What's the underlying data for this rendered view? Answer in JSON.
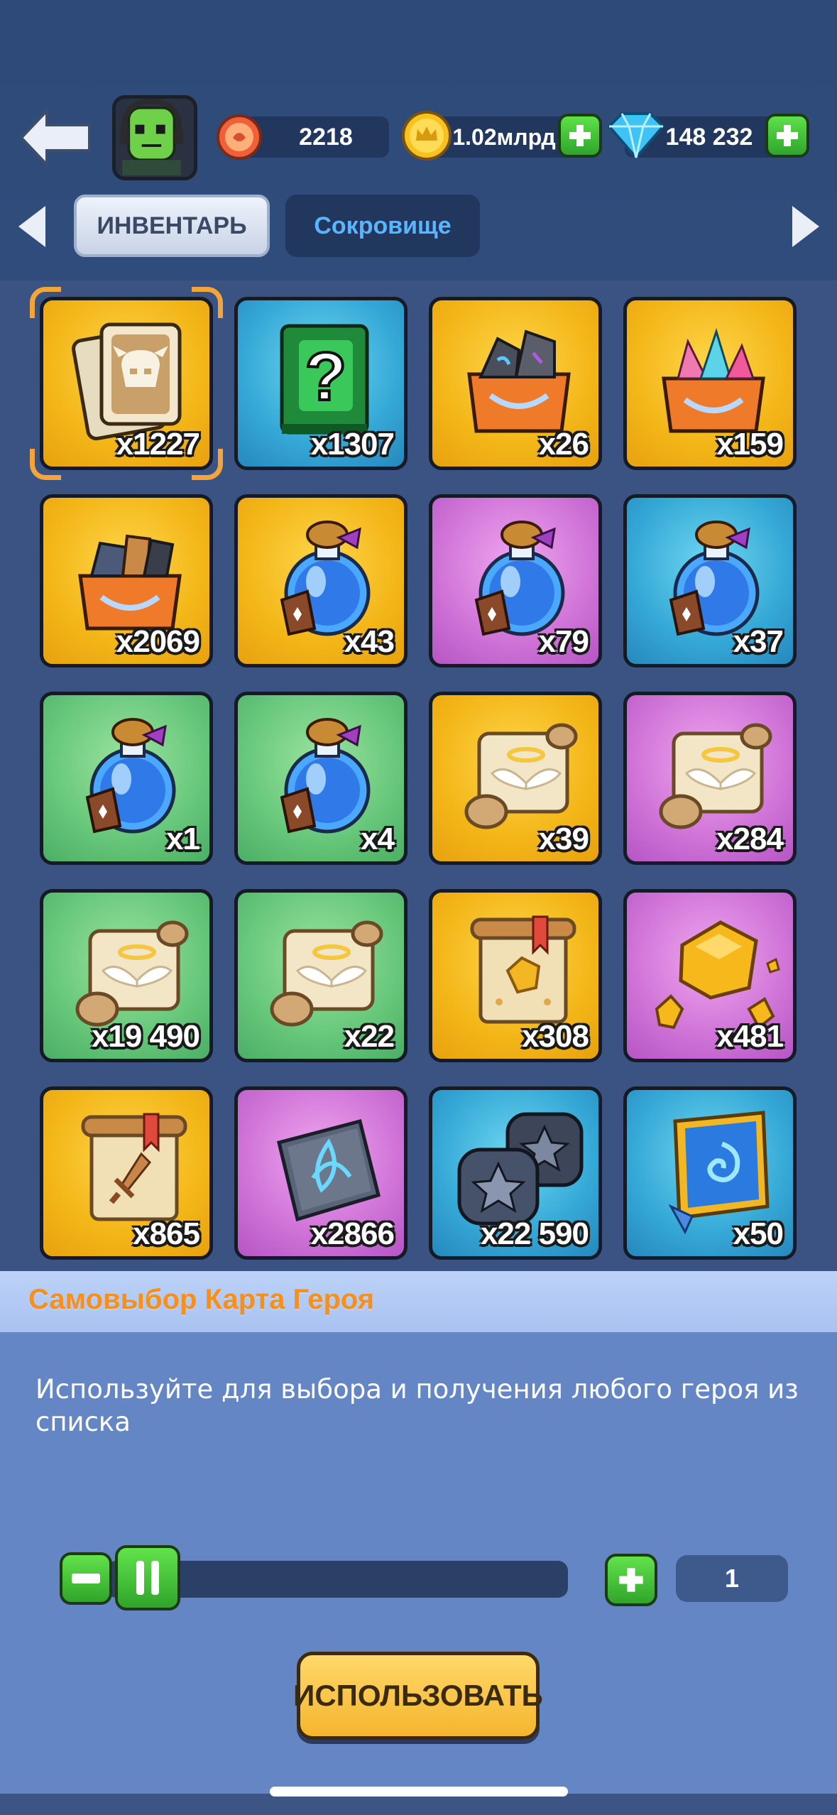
{
  "header": {
    "back_icon": "back-arrow-icon",
    "avatar_icon": "hero-avatar-icon",
    "resources": [
      {
        "name": "stamina",
        "icon": "medal-icon",
        "value": "2218"
      },
      {
        "name": "gold",
        "icon": "crown-coin-icon",
        "value": "1.02млрд"
      },
      {
        "name": "gems",
        "icon": "diamond-icon",
        "value": "148 232"
      }
    ]
  },
  "tabs": {
    "prev_icon": "chevron-left-icon",
    "next_icon": "chevron-right-icon",
    "items": [
      {
        "label": "ИНВЕНТАРЬ",
        "active": true
      },
      {
        "label": "Сокровище",
        "active": false
      }
    ]
  },
  "inventory": {
    "items": [
      {
        "icon": "hero-card-icon",
        "qty": "x1227",
        "rarity": "gold",
        "selected": true
      },
      {
        "icon": "mystery-book-icon",
        "qty": "x1307",
        "rarity": "blue"
      },
      {
        "icon": "rune-chest-icon",
        "qty": "x26",
        "rarity": "gold"
      },
      {
        "icon": "gem-chest-icon",
        "qty": "x159",
        "rarity": "gold"
      },
      {
        "icon": "ore-chest-icon",
        "qty": "x2069",
        "rarity": "gold"
      },
      {
        "icon": "xp-potion-icon",
        "qty": "x43",
        "rarity": "gold"
      },
      {
        "icon": "xp-potion-icon",
        "qty": "x79",
        "rarity": "purple"
      },
      {
        "icon": "xp-potion-icon",
        "qty": "x37",
        "rarity": "blue"
      },
      {
        "icon": "xp-potion-icon",
        "qty": "x1",
        "rarity": "green"
      },
      {
        "icon": "xp-potion-icon",
        "qty": "x4",
        "rarity": "green"
      },
      {
        "icon": "angel-scroll-icon",
        "qty": "x39",
        "rarity": "gold"
      },
      {
        "icon": "angel-scroll-icon",
        "qty": "x284",
        "rarity": "purple"
      },
      {
        "icon": "angel-scroll-icon",
        "qty": "x19 490",
        "rarity": "green"
      },
      {
        "icon": "angel-scroll-icon",
        "qty": "x22",
        "rarity": "green"
      },
      {
        "icon": "gold-map-scroll-icon",
        "qty": "x308",
        "rarity": "gold"
      },
      {
        "icon": "gold-ore-icon",
        "qty": "x481",
        "rarity": "purple"
      },
      {
        "icon": "sword-scroll-icon",
        "qty": "x865",
        "rarity": "gold"
      },
      {
        "icon": "rune-stone-icon",
        "qty": "x2866",
        "rarity": "purple"
      },
      {
        "icon": "star-coins-icon",
        "qty": "x22 590",
        "rarity": "blue"
      },
      {
        "icon": "spell-book-icon",
        "qty": "x50",
        "rarity": "blue"
      }
    ]
  },
  "details": {
    "title": "Самовыбор Карта Героя",
    "description": "Используйте для выбора и получения любого героя из списка",
    "quantity": "1",
    "slider_fraction": 0,
    "use_label": "ИСПОЛЬЗОВАТЬ"
  },
  "colors": {
    "gold": "#f3b618",
    "blue": "#35a8d6",
    "purple": "#cf73d7",
    "green": "#66c77a",
    "title_orange": "#f6901a"
  }
}
